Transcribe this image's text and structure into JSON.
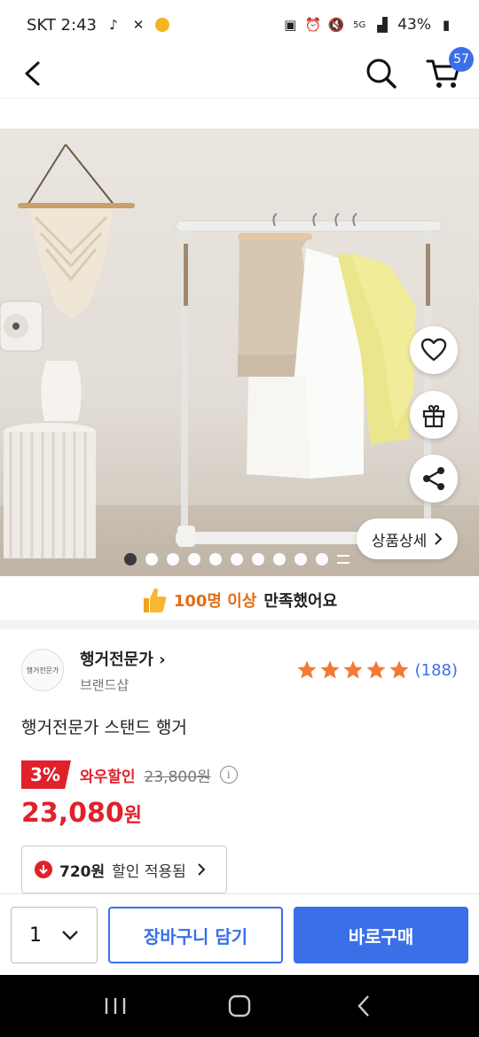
{
  "status_bar": {
    "carrier_time": "SKT 2:43",
    "battery": "43%"
  },
  "header": {
    "cart_count": "57"
  },
  "gallery": {
    "detail_button": "상품상세",
    "page_indicator": {
      "current": 1,
      "dots": 11
    }
  },
  "satisfaction": {
    "highlight": "100명 이상",
    "rest": "만족했어요"
  },
  "seller": {
    "name": "행거전문가",
    "logo_text": "행거전문가",
    "subtitle": "브랜드샵",
    "rating_stars": 5,
    "review_count": "(188)"
  },
  "product": {
    "title": "행거전문가 스탠드 행거",
    "discount_rate": "3%",
    "wow_label": "와우할인",
    "original_price": "23,800원",
    "sale_price": "23,080",
    "sale_unit": "원",
    "coupon_amount": "720원",
    "coupon_text": "할인 적용됨"
  },
  "purchase_bar": {
    "quantity": "1",
    "cart_button": "장바구니 담기",
    "buy_button": "바로구매"
  },
  "colors": {
    "accent_blue": "#3a6fe8",
    "sale_red": "#e0212c",
    "satisfaction_orange": "#e36d14",
    "star_orange": "#f27a36"
  }
}
